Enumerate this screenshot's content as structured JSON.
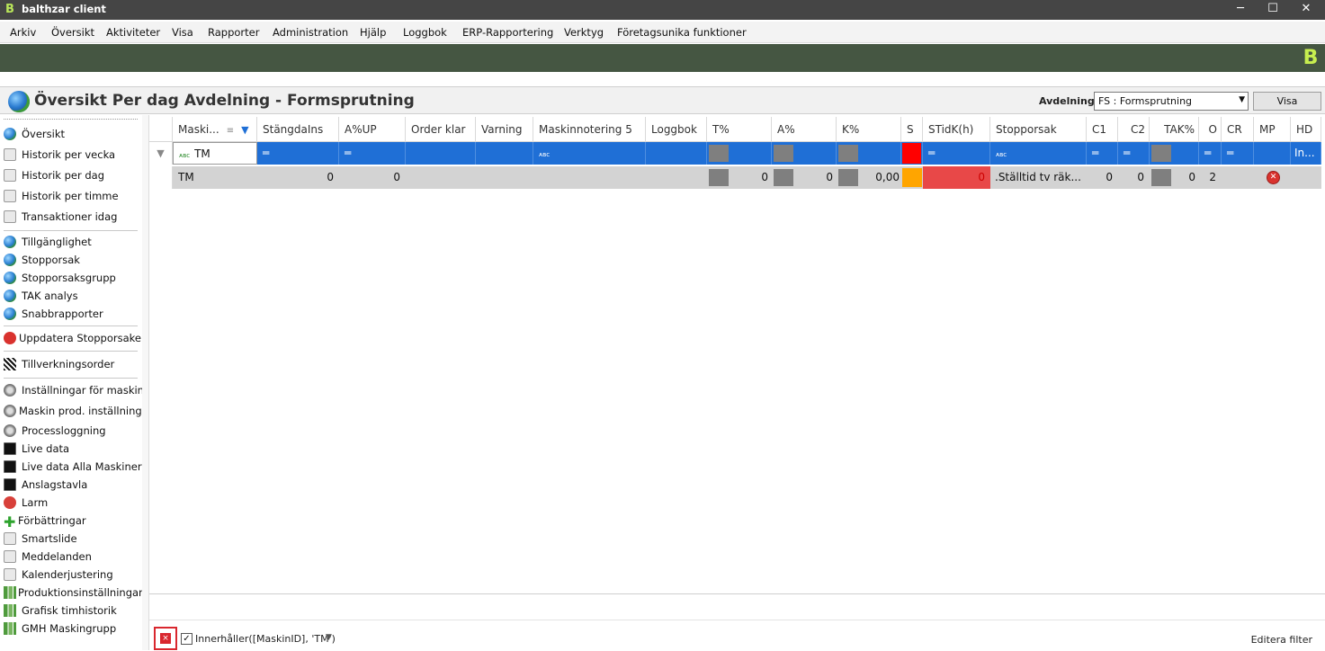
{
  "window": {
    "title": "balthzar client",
    "logo_glyph": "B",
    "min": "─",
    "max": "☐",
    "close": "✕"
  },
  "menu": [
    "Arkiv",
    "Översikt",
    "Aktiviteter",
    "Visa",
    "Rapporter",
    "Administration",
    "Hjälp",
    "Loggbok",
    "ERP-Rapportering",
    "Verktyg",
    "Företagsunika funktioner"
  ],
  "brand_logo": "B",
  "page": {
    "title": "Översikt Per dag Avdelning - Formsprutning",
    "avdelning_label": "Avdelning",
    "avdelning_value": "FS : Formsprutning",
    "visa_label": "Visa"
  },
  "sidebar": {
    "items": [
      "Översikt",
      "Historik per vecka",
      "Historik per dag",
      "Historik per timme",
      "Transaktioner idag",
      "Tillgänglighet",
      "Stopporsak",
      "Stopporsaksgrupp",
      "TAK analys",
      "Snabbrapporter",
      "Uppdatera Stopporsaker",
      "Tillverkningsorder",
      "Inställningar för maskin",
      "Maskin prod. inställning",
      "Processloggning",
      "Live data",
      "Live data Alla Maskiner",
      "Anslagstavla",
      "Larm",
      "Förbättringar",
      "Smartslide",
      "Meddelanden",
      "Kalenderjustering",
      "Produktionsinställningar",
      "Grafisk timhistorik",
      "GMH Maskingrupp"
    ]
  },
  "grid": {
    "columns": [
      "Maski...",
      "StängdaIns",
      "A%UP",
      "Order klar",
      "Varning",
      "Maskinnotering 5",
      "Loggbok",
      "T%",
      "A%",
      "K%",
      "S",
      "STidK(h)",
      "Stopporsak",
      "C1",
      "C2",
      "TAK%",
      "O",
      "CR",
      "MP",
      "HD"
    ],
    "filter": {
      "maskin": "TM",
      "eq": "═",
      "abc": "ᴀʙᴄ",
      "hd": "In..."
    },
    "row": {
      "maskin": "TM",
      "stangda": "0",
      "aup": "0",
      "t": "0",
      "a": "0",
      "k": "0,00",
      "stid": "0",
      "stopporsak": ".Ställtid tv räk...",
      "c1": "0",
      "c2": "0",
      "tak": "0",
      "o": "2"
    },
    "colors": {
      "s_filter": "#ff0000",
      "s_row": "#ffa500",
      "stid_row": "#e84848",
      "selected": "#1f6fd6"
    }
  },
  "statusbar": {
    "filter_text": "Innerhåller([MaskinID], 'TM')",
    "edit_filter": "Editera filter",
    "check": "✓",
    "x": "×"
  }
}
